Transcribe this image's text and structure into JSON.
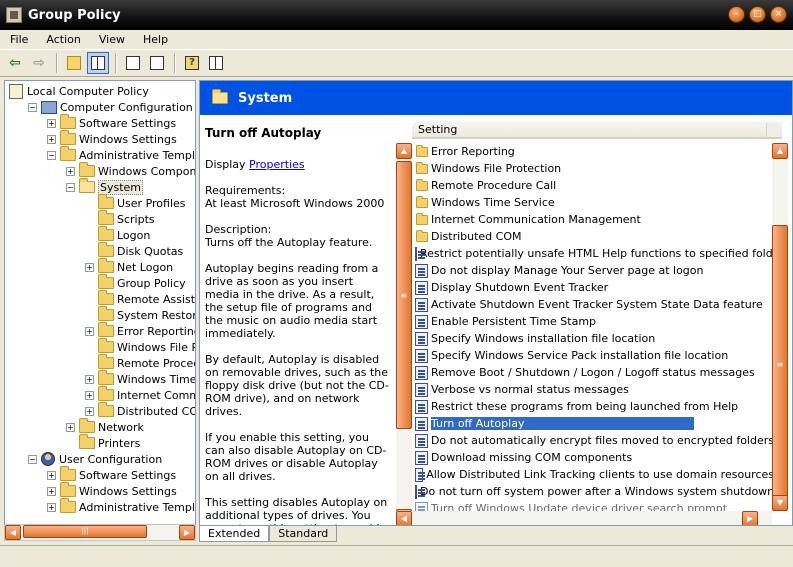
{
  "window": {
    "title": "Group Policy"
  },
  "menu": [
    "File",
    "Action",
    "View",
    "Help"
  ],
  "tree": {
    "items": [
      {
        "label": "Local Computer Policy",
        "icon": "policy-icon",
        "indent": 0,
        "expander": "none"
      },
      {
        "label": "Computer Configuration",
        "icon": "computer-icon",
        "indent": 1,
        "expander": "minus"
      },
      {
        "label": "Software Settings",
        "icon": "folder-icon",
        "indent": 2,
        "expander": "plus"
      },
      {
        "label": "Windows Settings",
        "icon": "folder-icon",
        "indent": 2,
        "expander": "plus"
      },
      {
        "label": "Administrative Templates",
        "icon": "folder-icon",
        "indent": 2,
        "expander": "minus"
      },
      {
        "label": "Windows Components",
        "icon": "folder-icon",
        "indent": 3,
        "expander": "plus"
      },
      {
        "label": "System",
        "icon": "folder-open-icon",
        "indent": 3,
        "expander": "minus",
        "selected": true
      },
      {
        "label": "User Profiles",
        "icon": "folder-icon",
        "indent": 4,
        "expander": "none"
      },
      {
        "label": "Scripts",
        "icon": "folder-icon",
        "indent": 4,
        "expander": "none"
      },
      {
        "label": "Logon",
        "icon": "folder-icon",
        "indent": 4,
        "expander": "none"
      },
      {
        "label": "Disk Quotas",
        "icon": "folder-icon",
        "indent": 4,
        "expander": "none"
      },
      {
        "label": "Net Logon",
        "icon": "folder-icon",
        "indent": 4,
        "expander": "plus"
      },
      {
        "label": "Group Policy",
        "icon": "folder-icon",
        "indent": 4,
        "expander": "none"
      },
      {
        "label": "Remote Assistance",
        "icon": "folder-icon",
        "indent": 4,
        "expander": "none"
      },
      {
        "label": "System Restore",
        "icon": "folder-icon",
        "indent": 4,
        "expander": "none"
      },
      {
        "label": "Error Reporting",
        "icon": "folder-icon",
        "indent": 4,
        "expander": "plus"
      },
      {
        "label": "Windows File Prote",
        "icon": "folder-icon",
        "indent": 4,
        "expander": "none"
      },
      {
        "label": "Remote Procedure",
        "icon": "folder-icon",
        "indent": 4,
        "expander": "none"
      },
      {
        "label": "Windows Time Serv",
        "icon": "folder-icon",
        "indent": 4,
        "expander": "plus"
      },
      {
        "label": "Internet Communic",
        "icon": "folder-icon",
        "indent": 4,
        "expander": "plus"
      },
      {
        "label": "Distributed COM",
        "icon": "folder-icon",
        "indent": 4,
        "expander": "plus"
      },
      {
        "label": "Network",
        "icon": "folder-icon",
        "indent": 3,
        "expander": "plus"
      },
      {
        "label": "Printers",
        "icon": "folder-icon",
        "indent": 3,
        "expander": "none"
      },
      {
        "label": "User Configuration",
        "icon": "user-icon",
        "indent": 1,
        "expander": "minus"
      },
      {
        "label": "Software Settings",
        "icon": "folder-icon",
        "indent": 2,
        "expander": "plus"
      },
      {
        "label": "Windows Settings",
        "icon": "folder-icon",
        "indent": 2,
        "expander": "plus"
      },
      {
        "label": "Administrative Templates",
        "icon": "folder-icon",
        "indent": 2,
        "expander": "plus"
      }
    ]
  },
  "header": {
    "title": "System"
  },
  "details": {
    "title": "Turn off Autoplay",
    "display_label": "Display",
    "properties_link": "Properties",
    "requirements_label": "Requirements:",
    "requirements_value": "At least Microsoft Windows 2000",
    "description_label": "Description:",
    "description_line": "Turns off the Autoplay feature.",
    "para1": "Autoplay begins reading from a drive as soon as you insert media in the drive. As a result, the setup file of programs and the music on audio media start immediately.",
    "para2": "By default, Autoplay is disabled on removable drives, such as the floppy disk drive (but not the CD-ROM drive), and on network drives.",
    "para3": "If you enable this setting, you can also disable Autoplay on CD-ROM drives or disable Autoplay on all drives.",
    "para4": "This setting disables Autoplay on additional types of drives. You cannot use this setting to enable Autoplay on drives on which it is disabled by default."
  },
  "list": {
    "column": "Setting",
    "rows": [
      {
        "label": "Error Reporting",
        "icon": "folder-icon"
      },
      {
        "label": "Windows File Protection",
        "icon": "folder-icon"
      },
      {
        "label": "Remote Procedure Call",
        "icon": "folder-icon"
      },
      {
        "label": "Windows Time Service",
        "icon": "folder-icon"
      },
      {
        "label": "Internet Communication Management",
        "icon": "folder-icon"
      },
      {
        "label": "Distributed COM",
        "icon": "folder-icon"
      },
      {
        "label": "Restrict potentially unsafe HTML Help functions to specified folders",
        "icon": "setting-icon"
      },
      {
        "label": "Do not display Manage Your Server page at logon",
        "icon": "setting-icon"
      },
      {
        "label": "Display Shutdown Event Tracker",
        "icon": "setting-icon"
      },
      {
        "label": "Activate Shutdown Event Tracker System State Data feature",
        "icon": "setting-icon"
      },
      {
        "label": "Enable Persistent Time Stamp",
        "icon": "setting-icon"
      },
      {
        "label": "Specify Windows installation file location",
        "icon": "setting-icon"
      },
      {
        "label": "Specify Windows Service Pack installation file location",
        "icon": "setting-icon"
      },
      {
        "label": "Remove Boot / Shutdown / Logon / Logoff status messages",
        "icon": "setting-icon"
      },
      {
        "label": "Verbose vs normal status messages",
        "icon": "setting-icon"
      },
      {
        "label": "Restrict these programs from being launched from Help",
        "icon": "setting-icon"
      },
      {
        "label": "Turn off Autoplay",
        "icon": "setting-icon",
        "selected": true
      },
      {
        "label": "Do not automatically encrypt files moved to encrypted folders",
        "icon": "setting-icon"
      },
      {
        "label": "Download missing COM components",
        "icon": "setting-icon"
      },
      {
        "label": "Allow Distributed Link Tracking clients to use domain resources",
        "icon": "setting-icon"
      },
      {
        "label": "Do not turn off system power after a Windows system shutdown ...",
        "icon": "setting-icon"
      },
      {
        "label": "Turn off Windows Update device driver search prompt",
        "icon": "setting-icon",
        "partial": true
      }
    ]
  },
  "tabs": [
    "Extended",
    "Standard"
  ],
  "active_tab": "Extended",
  "colors": {
    "header_blue": "#0053e2",
    "selection": "#316ac5",
    "scroll_orange": "#e2762c"
  }
}
